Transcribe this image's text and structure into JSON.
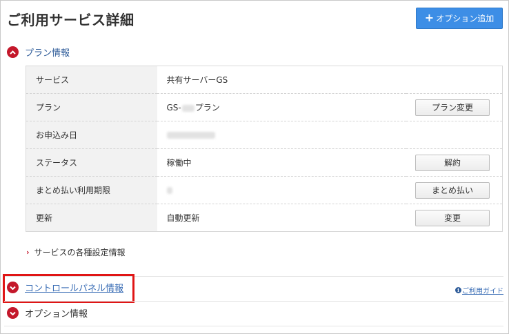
{
  "header": {
    "title": "ご利用サービス詳細",
    "add_option_label": "オプション追加"
  },
  "plan_section": {
    "title": "プラン情報",
    "rows": [
      {
        "label": "サービス",
        "value": "共有サーバーGS"
      },
      {
        "label": "プラン",
        "value_prefix": "GS-",
        "value_suffix": "プラン",
        "button": "プラン変更"
      },
      {
        "label": "お申込み日"
      },
      {
        "label": "ステータス",
        "value": "稼働中",
        "button": "解約"
      },
      {
        "label": "まとめ払い利用期限",
        "button": "まとめ払い"
      },
      {
        "label": "更新",
        "value": "自動更新",
        "button": "変更"
      }
    ],
    "settings_link": "サービスの各種設定情報"
  },
  "control_section": {
    "title": "コントロールパネル情報",
    "guide_link": "ご利用ガイド"
  },
  "option_section": {
    "title": "オプション情報"
  },
  "colors": {
    "accent_red": "#c4182b",
    "primary_blue": "#3d8ee6",
    "highlight_red": "#e01515",
    "link_blue": "#3a6db5"
  }
}
